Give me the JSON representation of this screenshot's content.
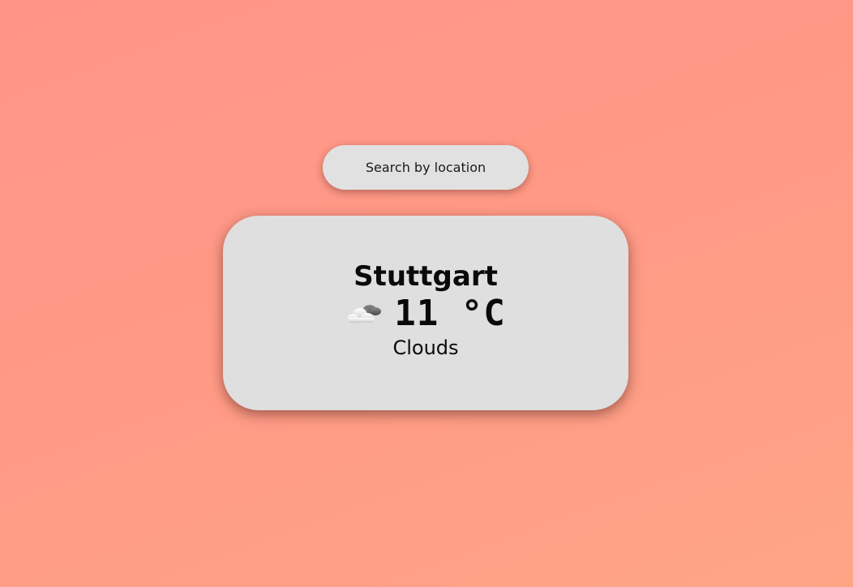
{
  "search": {
    "placeholder": "Search by location",
    "value": ""
  },
  "weather": {
    "city": "Stuttgart",
    "temperature": "11 °C",
    "condition": "Clouds",
    "icon": "cloud-icon"
  },
  "colors": {
    "background_start": "#ff9487",
    "background_end": "#ffa586",
    "card": "#dfdfdf",
    "search": "#e1e1e1",
    "text": "#0a0a0a"
  }
}
